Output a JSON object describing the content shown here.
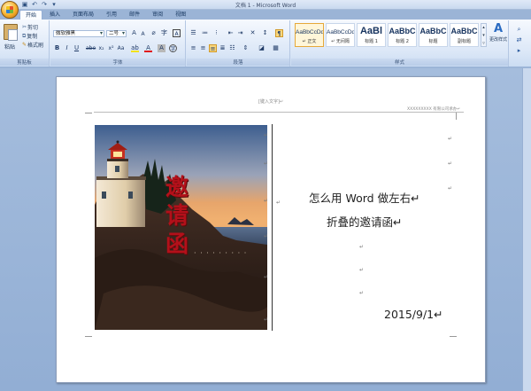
{
  "titlebar": {
    "title": "文档 1 - Microsoft Word"
  },
  "tabs": [
    {
      "label": "开始"
    },
    {
      "label": "插入"
    },
    {
      "label": "页面布局"
    },
    {
      "label": "引用"
    },
    {
      "label": "邮件"
    },
    {
      "label": "审阅"
    },
    {
      "label": "视图"
    }
  ],
  "clipboard": {
    "paste": "粘贴",
    "cut": "剪切",
    "copy": "复制",
    "format_painter": "格式刷",
    "label": "剪贴板"
  },
  "font": {
    "name": "微软雅黑",
    "size": "二号",
    "label": "字体"
  },
  "paragraph": {
    "label": "段落"
  },
  "styles": {
    "label": "样式",
    "items": [
      {
        "sample": "AaBbCcDd",
        "name": "↵ 正文"
      },
      {
        "sample": "AaBbCcDd",
        "name": "↵ 无间隔"
      },
      {
        "sample": "AaBl",
        "name": "标题 1"
      },
      {
        "sample": "AaBbC",
        "name": "标题 2"
      },
      {
        "sample": "AaBbC",
        "name": "标题"
      },
      {
        "sample": "AaBbC",
        "name": "副标题"
      }
    ],
    "change_styles": "更改样式"
  },
  "document": {
    "header_placeholder": "[键入文字]↵",
    "header_right": "XXXXXXXXX 有限公司承办↵",
    "photo_title": "邀请函",
    "line1": "怎么用 Word 做左右↵",
    "line2": "折叠的邀请函↵",
    "date": "2015/9/1↵",
    "para_mark": "↵"
  },
  "colors": {
    "accent": "#d26a1e",
    "ribbon": "#dbe7f7",
    "title_red": "#b3101a"
  }
}
